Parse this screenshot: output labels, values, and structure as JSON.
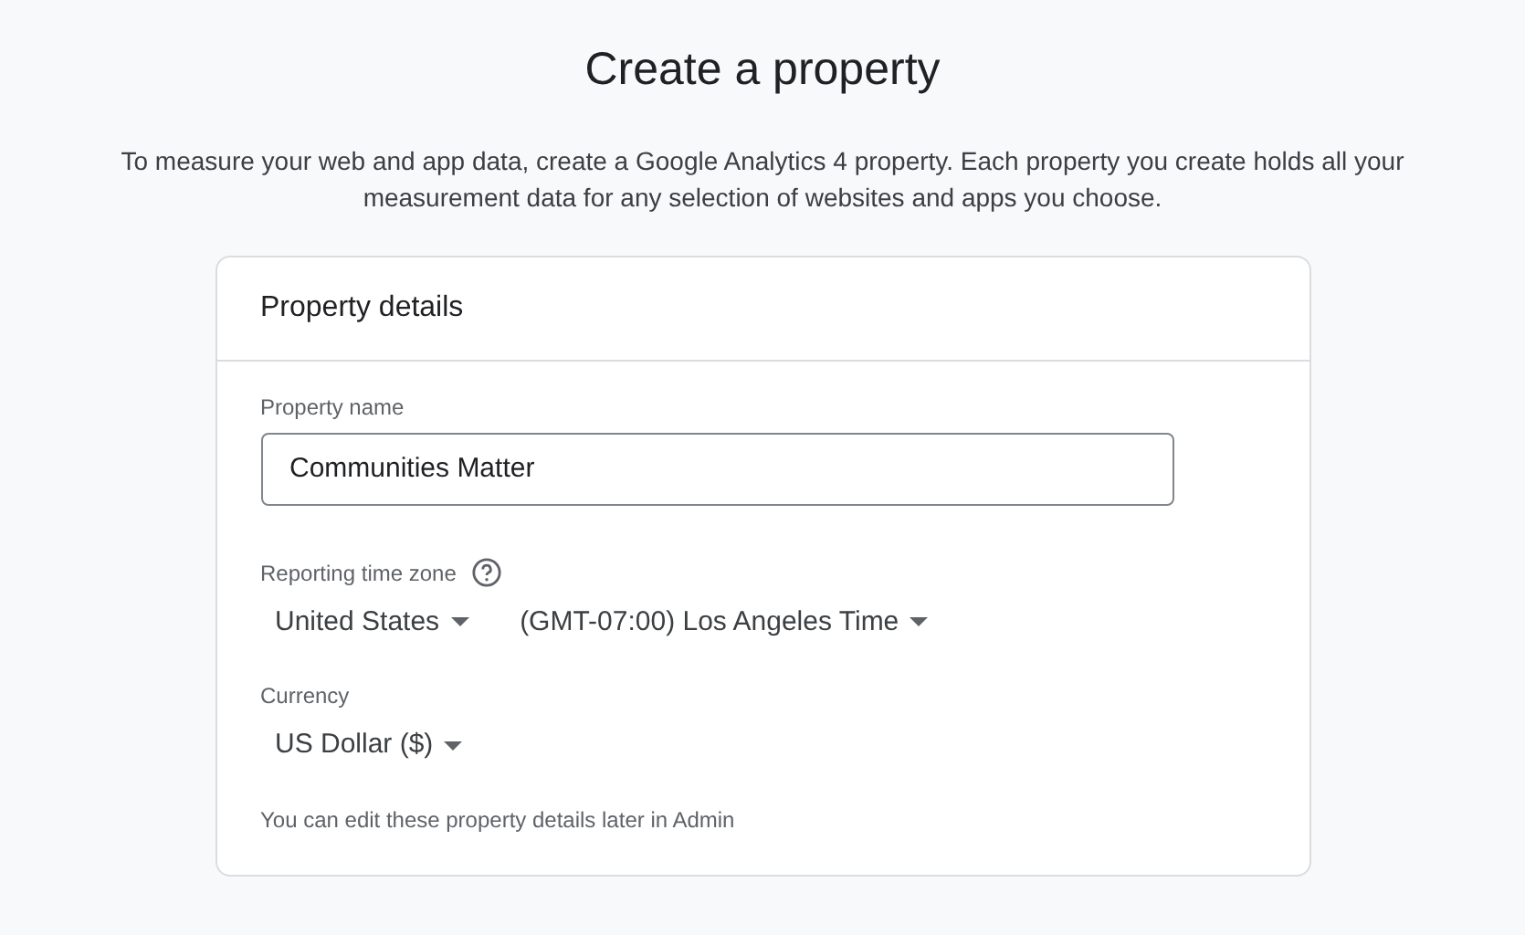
{
  "title": "Create a property",
  "description": "To measure your web and app data, create a Google Analytics 4 property. Each property you create holds all your measurement data for any selection of websites and apps you choose.",
  "card": {
    "header": "Property details",
    "property_name": {
      "label": "Property name",
      "value": "Communities Matter"
    },
    "time_zone": {
      "label": "Reporting time zone",
      "dropdowns": [
        "United States",
        "(GMT-07:00) Los Angeles Time"
      ]
    },
    "currency": {
      "label": "Currency",
      "dropdowns": [
        "US Dollar ($)"
      ]
    },
    "note": "You can edit these property details later in Admin"
  }
}
